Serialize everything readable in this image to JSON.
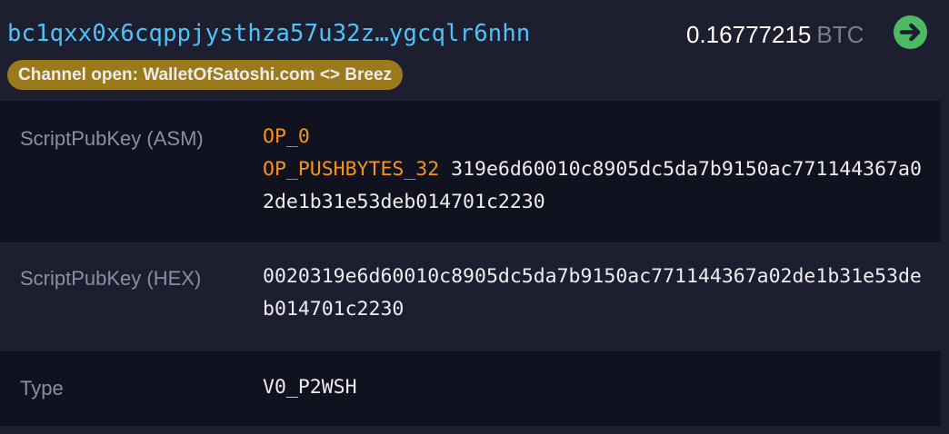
{
  "header": {
    "address": "bc1qxx0x6cqppjysthza57u32z…ygcqlr6nhn",
    "amount_value": "0.16777215",
    "amount_unit": "BTC",
    "badge_label": "Channel open: WalletOfSatoshi.com <> Breez",
    "go_icon": "arrow-right-circle-icon"
  },
  "colors": {
    "address": "#4fc3f7",
    "opcode": "#f7931a",
    "badge": "#9b7a1b",
    "go_button": "#4cba64"
  },
  "details": {
    "asm": {
      "label": "ScriptPubKey (ASM)",
      "op1": "OP_0",
      "op2": "OP_PUSHBYTES_32",
      "data": "319e6d60010c8905dc5da7b9150ac771144367a02de1b31e53deb014701c2230"
    },
    "hex": {
      "label": "ScriptPubKey (HEX)",
      "value": "0020319e6d60010c8905dc5da7b9150ac771144367a02de1b31e53deb014701c2230"
    },
    "type": {
      "label": "Type",
      "value": "V0_P2WSH"
    }
  }
}
